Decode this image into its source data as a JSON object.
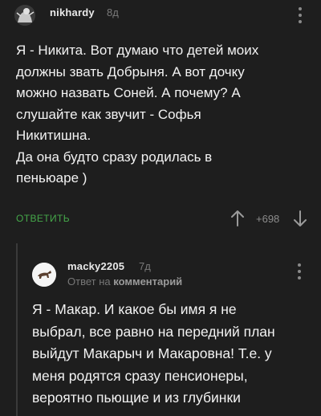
{
  "comments": [
    {
      "author": "nikhardy",
      "time": "8д",
      "text": "Я - Никита. Вот думаю что детей моих\nдолжны звать Добрыня. А вот дочку\nможно назвать Соней. А почему? А\nслушайте как звучит - Софья\nНикитишна.\nДа она будто сразу родилась в\nпеньюаре )",
      "reply_label": "ОТВЕТИТЬ",
      "rating": "+698",
      "icons": {
        "avatar": "avatar-gray-creature",
        "more": "more-vertical-icon",
        "upvote": "arrow-up-icon",
        "downvote": "arrow-down-icon"
      }
    },
    {
      "author": "macky2205",
      "time": "7д",
      "reply_prefix": "Ответ на",
      "reply_target": "комментарий",
      "text": "Я - Макар. И какое бы имя я не\nвыбрал, все равно на передний план\nвыйдут Макарыч и Макаровна! Т.е. у\nменя родятся сразу пенсионеры,\nвероятно пьющие и из глубинки",
      "icons": {
        "avatar": "avatar-dog-on-white",
        "more": "more-vertical-icon"
      }
    }
  ],
  "colors": {
    "background": "#1e1e1e",
    "text": "#f2f2f2",
    "accent_reply": "#45a84a",
    "muted": "#7a7a7a",
    "thread_line": "#3a3a3a"
  }
}
